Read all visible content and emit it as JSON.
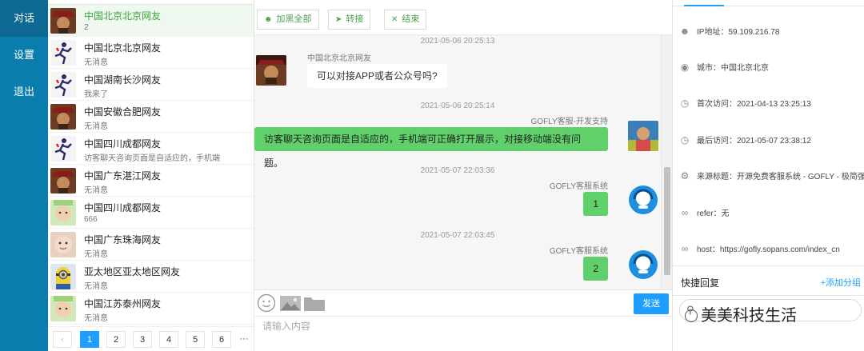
{
  "nav": {
    "items": [
      "对话",
      "设置",
      "退出"
    ]
  },
  "visitors": [
    {
      "name": "中国北京北京网友",
      "msg": "2",
      "avatar": "pirate"
    },
    {
      "name": "中国北京北京网友",
      "msg": "无消息",
      "avatar": "runner"
    },
    {
      "name": "中国湖南长沙网友",
      "msg": "我来了",
      "avatar": "runner"
    },
    {
      "name": "中国安徽合肥网友",
      "msg": "无消息",
      "avatar": "pirate"
    },
    {
      "name": "中国四川成都网友",
      "msg": "访客聊天咨询页面是自适应的，手机端",
      "avatar": "runner"
    },
    {
      "name": "中国广东湛江网友",
      "msg": "无消息",
      "avatar": "pirate"
    },
    {
      "name": "中国四川成都网友",
      "msg": "666",
      "avatar": "baby"
    },
    {
      "name": "中国广东珠海网友",
      "msg": "无消息",
      "avatar": "face"
    },
    {
      "name": "亚太地区亚太地区网友",
      "msg": "无消息",
      "avatar": "minion"
    },
    {
      "name": "中国江苏泰州网友",
      "msg": "无消息",
      "avatar": "baby"
    }
  ],
  "pagination": {
    "prev": "‹",
    "pages": [
      "1",
      "2",
      "3",
      "4",
      "5",
      "6"
    ],
    "more": "···",
    "current": "1"
  },
  "toolbar": {
    "add_blacklist": "加黑全部",
    "transfer": "转接",
    "end": "结束"
  },
  "messages": {
    "t1": "2021-05-06 20:25:13",
    "m1_sender": "中国北京北京网友",
    "m1_text": "可以对接APP或者公众号吗?",
    "t2": "2021-05-06 20:25:14",
    "m2_sender": "GOFLY客服-开发支持",
    "m2_text": "访客聊天咨询页面是自适应的，手机端可正确打开展示，对接移动端没有问题。",
    "t3": "2021-05-07 22:03:36",
    "m3_sender": "GOFLY客服系统",
    "m3_text": "1",
    "t4": "2021-05-07 22:03:45",
    "m4_sender": "GOFLY客服系统",
    "m4_text": "2"
  },
  "input": {
    "placeholder": "请输入内容",
    "send": "发送"
  },
  "info": {
    "ip": "IP地址：59.109.216.78",
    "city": "城市：中国北京北京",
    "first_visit": "首次访问：2021-04-13 23:25:13",
    "last_visit": "最后访问：2021-05-07 23:38:12",
    "source": "来源标题：开源免费客服系统 - GOFLY - 极简强大",
    "refer": "refer：无",
    "host": "host：https://gofly.sopans.com/index_cn",
    "quick_reply": "快捷回复",
    "add_group": "+添加分组"
  },
  "watermark": "美美科技生活",
  "colors": {
    "nav": "#0a7dad",
    "accent": "#1e9fff",
    "bubble_me": "#5fd06a"
  }
}
